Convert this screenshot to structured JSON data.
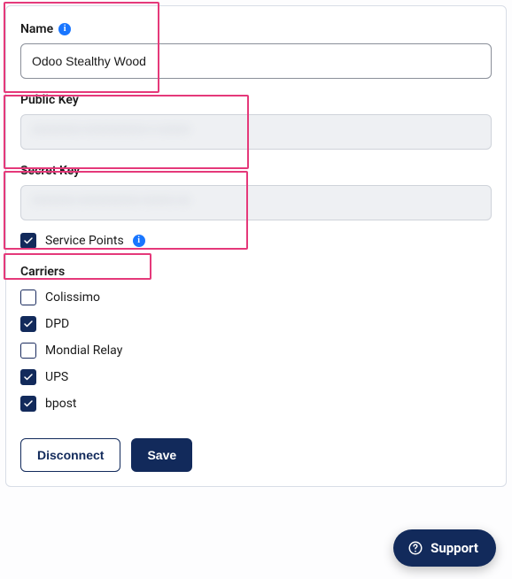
{
  "fields": {
    "name": {
      "label": "Name",
      "value": "Odoo Stealthy Wood"
    },
    "public_key": {
      "label": "Public Key",
      "value_mask": "xxxxxxxx-xxxxxxxxxx-x-xxxxx"
    },
    "secret_key": {
      "label": "Secret Key",
      "value_mask": "xxxxxxx-xxxxxxxxxx-xxxxx-xx"
    }
  },
  "service_points": {
    "label": "Service Points",
    "checked": true
  },
  "carriers": {
    "heading": "Carriers",
    "items": [
      {
        "label": "Colissimo",
        "checked": false
      },
      {
        "label": "DPD",
        "checked": true
      },
      {
        "label": "Mondial Relay",
        "checked": false
      },
      {
        "label": "UPS",
        "checked": true
      },
      {
        "label": "bpost",
        "checked": true
      }
    ]
  },
  "actions": {
    "disconnect": "Disconnect",
    "save": "Save"
  },
  "support": {
    "label": "Support"
  }
}
